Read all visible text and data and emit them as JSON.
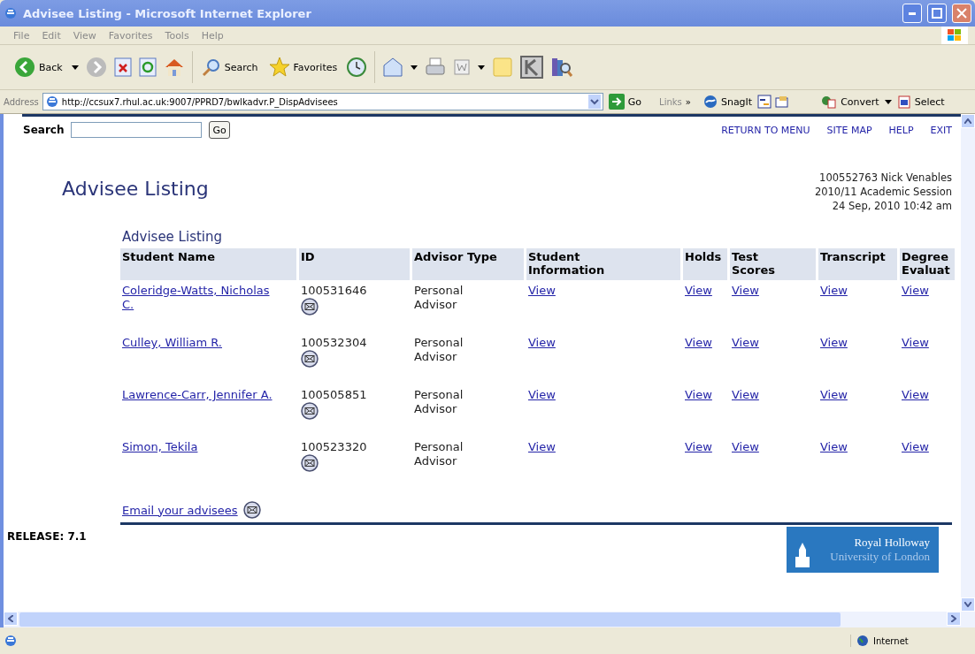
{
  "window": {
    "title": "Advisee Listing - Microsoft Internet Explorer"
  },
  "menu": [
    "File",
    "Edit",
    "View",
    "Favorites",
    "Tools",
    "Help"
  ],
  "toolbar": {
    "back": "Back",
    "search": "Search",
    "favorites": "Favorites"
  },
  "address_bar": {
    "label": "Address",
    "url": "http://ccsux7.rhul.ac.uk:9007/PPRD7/bwlkadvr.P_DispAdvisees",
    "go": "Go",
    "links": "Links",
    "links_more": "»",
    "snagit": "SnagIt",
    "convert": "Convert",
    "select": "Select"
  },
  "page": {
    "search_label": "Search",
    "search_button": "Go",
    "nav_links": [
      "RETURN TO MENU",
      "SITE MAP",
      "HELP",
      "EXIT"
    ],
    "heading": "Advisee Listing",
    "user_info": [
      "100552763 Nick Venables",
      "2010/11 Academic Session",
      "24 Sep, 2010 10:42 am"
    ],
    "table_title": "Advisee Listing",
    "columns": [
      "Student Name",
      "ID",
      "Advisor Type",
      "Student Information",
      "Holds",
      "Test Scores",
      "Transcript",
      "Degree Evaluat"
    ],
    "rows": [
      {
        "name": "Coleridge-Watts, Nicholas C.",
        "id": "100531646",
        "advisor_type": "Personal Advisor",
        "links": [
          "View",
          "View",
          "View",
          "View",
          "View"
        ]
      },
      {
        "name": "Culley, William R.",
        "id": "100532304",
        "advisor_type": "Personal Advisor",
        "links": [
          "View",
          "View",
          "View",
          "View",
          "View"
        ]
      },
      {
        "name": "Lawrence-Carr, Jennifer A.",
        "id": "100505851",
        "advisor_type": "Personal Advisor",
        "links": [
          "View",
          "View",
          "View",
          "View",
          "View"
        ]
      },
      {
        "name": "Simon, Tekila",
        "id": "100523320",
        "advisor_type": "Personal Advisor",
        "links": [
          "View",
          "View",
          "View",
          "View",
          "View"
        ]
      }
    ],
    "email_link": "Email your advisees",
    "release": "RELEASE: 7.1",
    "logo": {
      "line1": "Royal Holloway",
      "line2": "University of London"
    }
  },
  "status_bar": {
    "zone": "Internet"
  }
}
